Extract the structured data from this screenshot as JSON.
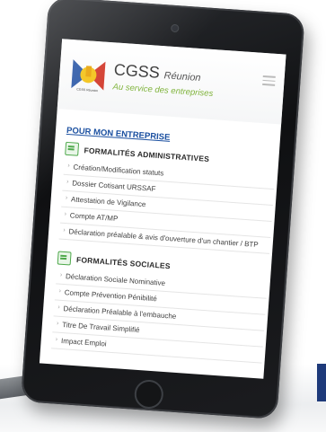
{
  "brand": {
    "name": "CGSS",
    "name_suffix": "Réunion",
    "tagline": "Au service des entreprises",
    "logo_caption": "CGSS Réunion"
  },
  "section_title": "POUR MON ENTREPRISE",
  "groups": [
    {
      "label": "FORMALITÉS ADMINISTRATIVES",
      "items": [
        "Création/Modification statuts",
        "Dossier Cotisant URSSAF",
        "Attestation de Vigilance",
        "Compte AT/MP",
        "Déclaration préalable & avis d'ouverture d'un chantier / BTP"
      ]
    },
    {
      "label": "FORMALITÉS SOCIALES",
      "items": [
        "Déclaration Sociale Nominative",
        "Compte Prévention Pénibilité",
        "Déclaration Préalable à l'embauche",
        "Titre De Travail Simplifié",
        "Impact Emploi"
      ]
    }
  ],
  "colors": {
    "link_blue": "#1a4fa0",
    "tagline_green": "#7fb33a",
    "icon_green": "#4da84a"
  }
}
